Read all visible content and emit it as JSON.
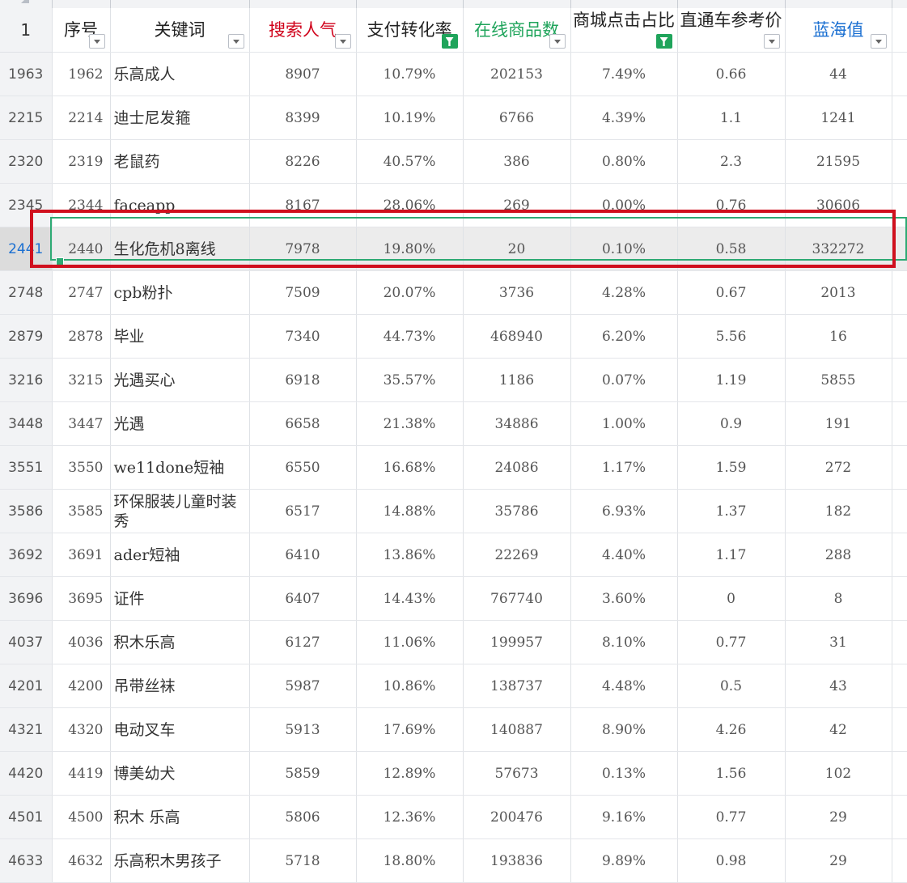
{
  "header": {
    "corner_label": "1",
    "columns": [
      {
        "label": "序号",
        "filter_active": false
      },
      {
        "label": "关键词",
        "filter_active": false
      },
      {
        "label": "搜索人气",
        "filter_active": false
      },
      {
        "label": "支付转化率",
        "filter_active": true
      },
      {
        "label": "在线商品数",
        "filter_active": false
      },
      {
        "label": "商城点击占比",
        "filter_active": true
      },
      {
        "label": "直通车参考价",
        "filter_active": false
      },
      {
        "label": "蓝海值",
        "filter_active": false
      }
    ]
  },
  "colors": {
    "search_header": "#d0021b",
    "online_header": "#1fa45b",
    "bluesea_header": "#1a6fd1",
    "selection_border": "#2eaa74",
    "highlight_box": "#d0101e"
  },
  "selected_row_index": 4,
  "rows": [
    {
      "row": "1963",
      "seq": "1962",
      "kw": "乐高成人",
      "search": "8907",
      "conv": "10.79%",
      "online": "202153",
      "click": "7.49%",
      "ztc": "0.66",
      "blue": "44"
    },
    {
      "row": "2215",
      "seq": "2214",
      "kw": "迪士尼发箍",
      "search": "8399",
      "conv": "10.19%",
      "online": "6766",
      "click": "4.39%",
      "ztc": "1.1",
      "blue": "1241"
    },
    {
      "row": "2320",
      "seq": "2319",
      "kw": "老鼠药",
      "search": "8226",
      "conv": "40.57%",
      "online": "386",
      "click": "0.80%",
      "ztc": "2.3",
      "blue": "21595"
    },
    {
      "row": "2345",
      "seq": "2344",
      "kw": "faceapp",
      "search": "8167",
      "conv": "28.06%",
      "online": "269",
      "click": "0.00%",
      "ztc": "0.76",
      "blue": "30606"
    },
    {
      "row": "2441",
      "seq": "2440",
      "kw": "生化危机8离线",
      "search": "7978",
      "conv": "19.80%",
      "online": "20",
      "click": "0.10%",
      "ztc": "0.58",
      "blue": "332272"
    },
    {
      "row": "2748",
      "seq": "2747",
      "kw": "cpb粉扑",
      "search": "7509",
      "conv": "20.07%",
      "online": "3736",
      "click": "4.28%",
      "ztc": "0.67",
      "blue": "2013"
    },
    {
      "row": "2879",
      "seq": "2878",
      "kw": "毕业",
      "search": "7340",
      "conv": "44.73%",
      "online": "468940",
      "click": "6.20%",
      "ztc": "5.56",
      "blue": "16"
    },
    {
      "row": "3216",
      "seq": "3215",
      "kw": "光遇买心",
      "search": "6918",
      "conv": "35.57%",
      "online": "1186",
      "click": "0.07%",
      "ztc": "1.19",
      "blue": "5855"
    },
    {
      "row": "3448",
      "seq": "3447",
      "kw": "光遇",
      "search": "6658",
      "conv": "21.38%",
      "online": "34886",
      "click": "1.00%",
      "ztc": "0.9",
      "blue": "191"
    },
    {
      "row": "3551",
      "seq": "3550",
      "kw": "we11done短袖",
      "search": "6550",
      "conv": "16.68%",
      "online": "24086",
      "click": "1.17%",
      "ztc": "1.59",
      "blue": "272"
    },
    {
      "row": "3586",
      "seq": "3585",
      "kw": "环保服装儿童时装秀",
      "search": "6517",
      "conv": "14.88%",
      "online": "35786",
      "click": "6.93%",
      "ztc": "1.37",
      "blue": "182"
    },
    {
      "row": "3692",
      "seq": "3691",
      "kw": "ader短袖",
      "search": "6410",
      "conv": "13.86%",
      "online": "22269",
      "click": "4.40%",
      "ztc": "1.17",
      "blue": "288"
    },
    {
      "row": "3696",
      "seq": "3695",
      "kw": "证件",
      "search": "6407",
      "conv": "14.43%",
      "online": "767740",
      "click": "3.60%",
      "ztc": "0",
      "blue": "8"
    },
    {
      "row": "4037",
      "seq": "4036",
      "kw": "积木乐高",
      "search": "6127",
      "conv": "11.06%",
      "online": "199957",
      "click": "8.10%",
      "ztc": "0.77",
      "blue": "31"
    },
    {
      "row": "4201",
      "seq": "4200",
      "kw": "吊带丝袜",
      "search": "5987",
      "conv": "10.86%",
      "online": "138737",
      "click": "4.48%",
      "ztc": "0.5",
      "blue": "43"
    },
    {
      "row": "4321",
      "seq": "4320",
      "kw": "电动叉车",
      "search": "5913",
      "conv": "17.69%",
      "online": "140887",
      "click": "8.90%",
      "ztc": "4.26",
      "blue": "42"
    },
    {
      "row": "4420",
      "seq": "4419",
      "kw": "博美幼犬",
      "search": "5859",
      "conv": "12.89%",
      "online": "57673",
      "click": "0.13%",
      "ztc": "1.56",
      "blue": "102"
    },
    {
      "row": "4501",
      "seq": "4500",
      "kw": "积木 乐高",
      "search": "5806",
      "conv": "12.36%",
      "online": "200476",
      "click": "9.16%",
      "ztc": "0.77",
      "blue": "29"
    },
    {
      "row": "4633",
      "seq": "4632",
      "kw": "乐高积木男孩子",
      "search": "5718",
      "conv": "18.80%",
      "online": "193836",
      "click": "9.89%",
      "ztc": "0.98",
      "blue": "29"
    }
  ]
}
